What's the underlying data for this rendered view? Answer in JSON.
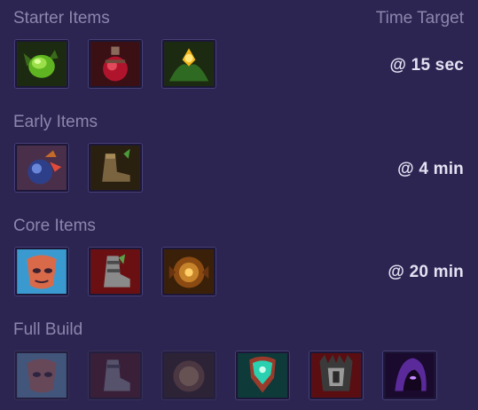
{
  "sections": {
    "starter": {
      "title": "Starter Items",
      "time": "@ 15 sec"
    },
    "early": {
      "title": "Early Items",
      "time": "@ 4 min"
    },
    "core": {
      "title": "Core Items",
      "time": "@ 20 min"
    },
    "full": {
      "title": "Full Build"
    }
  },
  "time_header": "Time Target",
  "icons": {
    "starter": [
      "green-seed-item-icon",
      "red-potion-item-icon",
      "golden-pod-item-icon"
    ],
    "early": [
      "blue-bomb-item-icon",
      "basic-boots-item-icon"
    ],
    "core": [
      "masked-face-item-icon",
      "armored-boots-item-icon",
      "bronze-orb-item-icon"
    ],
    "full": [
      "masked-face-item-icon-faded",
      "armored-boots-item-icon-faded",
      "bronze-orb-item-icon-faded",
      "teal-helm-item-icon",
      "spiked-armor-item-icon",
      "purple-hood-item-icon"
    ]
  },
  "colors": {
    "background": "#2c2552",
    "header_text": "#8c86ad",
    "time_text": "#e4e1f2",
    "icon_border": "#1c1738"
  }
}
